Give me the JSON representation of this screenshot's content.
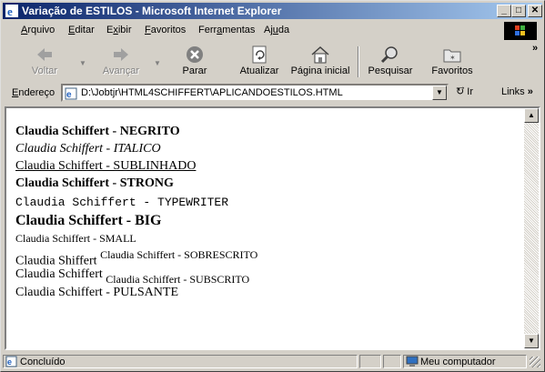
{
  "window": {
    "title": "Variação de ESTILOS - Microsoft Internet Explorer",
    "min": "_",
    "max": "□",
    "close": "✕"
  },
  "menu": {
    "items": [
      {
        "pre": "",
        "u": "A",
        "post": "rquivo"
      },
      {
        "pre": "",
        "u": "E",
        "post": "ditar"
      },
      {
        "pre": "E",
        "u": "x",
        "post": "ibir"
      },
      {
        "pre": "",
        "u": "F",
        "post": "avoritos"
      },
      {
        "pre": "Ferr",
        "u": "a",
        "post": "mentas"
      },
      {
        "pre": "Aj",
        "u": "u",
        "post": "da"
      }
    ]
  },
  "toolbar": {
    "back": "Voltar",
    "forward": "Avançar",
    "stop": "Parar",
    "refresh": "Atualizar",
    "home": "Página inicial",
    "search": "Pesquisar",
    "favorites": "Favoritos",
    "more": "»"
  },
  "address": {
    "label": "Endereço",
    "url": "D:\\Jobtjr\\HTML4SCHIFFERT\\APLICANDOESTILOS.HTML",
    "go": "Ir",
    "links": "Links",
    "links_more": "»"
  },
  "document": {
    "bold": "Claudia Schiffert - NEGRITO",
    "italic": "Claudia Schiffert - ITALICO",
    "underline": "Claudia Schiffert - SUBLINHADO",
    "strong": "Claudia Schiffert - STRONG",
    "typewriter": "Claudia Schiffert - TYPEWRITER",
    "big": "Claudia Schiffert - BIG",
    "small": "Claudia Schiffert - SMALL",
    "sup_base": "Claudia Shiffert",
    "sup_text": "Claudia Schiffert - SOBRESCRITO",
    "sub_base": "Claudia Schiffert",
    "sub_text": "Claudia Schiffert - SUBSCRITO",
    "blink": "Claudia Schiffert - PULSANTE"
  },
  "status": {
    "text": "Concluído",
    "zone": "Meu computador"
  }
}
